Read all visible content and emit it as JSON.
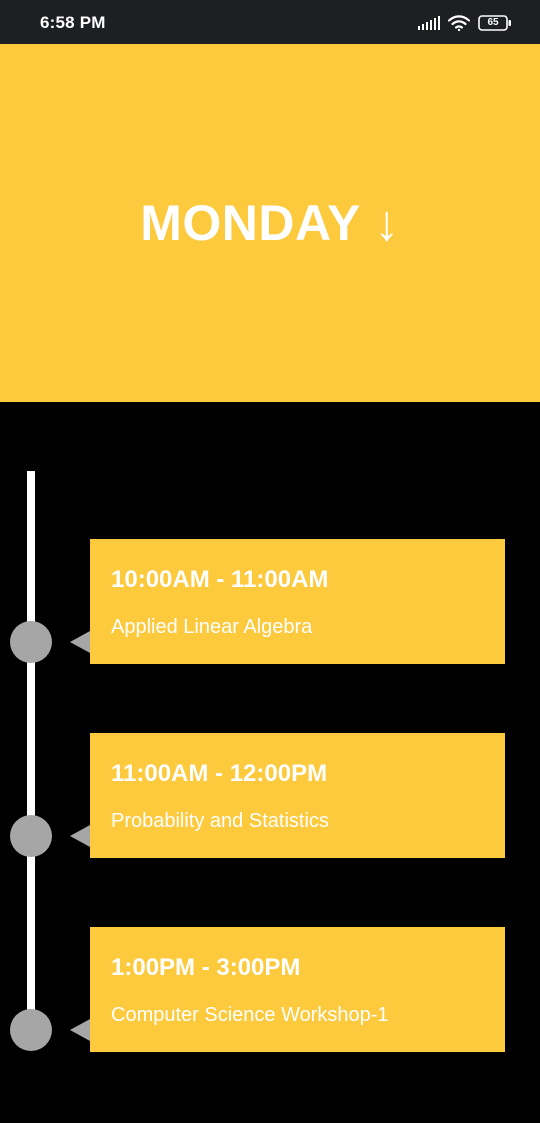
{
  "status_bar": {
    "time": "6:58 PM",
    "battery": "65",
    "icons": [
      "signal-icon",
      "wifi-icon",
      "battery-icon"
    ]
  },
  "header": {
    "day": "MONDAY ↓"
  },
  "schedule": [
    {
      "time": "10:00AM - 11:00AM",
      "subject": "Applied Linear Algebra"
    },
    {
      "time": "11:00AM - 12:00PM",
      "subject": "Probability and Statistics"
    },
    {
      "time": "1:00PM - 3:00PM",
      "subject": "Computer Science Workshop-1"
    }
  ],
  "colors": {
    "accent": "#fdc93d",
    "background": "#000000",
    "status_bar": "#1e1f23",
    "timeline_dot": "#a6a6a6",
    "timeline_line": "#ffffff",
    "text": "#ffffff"
  }
}
